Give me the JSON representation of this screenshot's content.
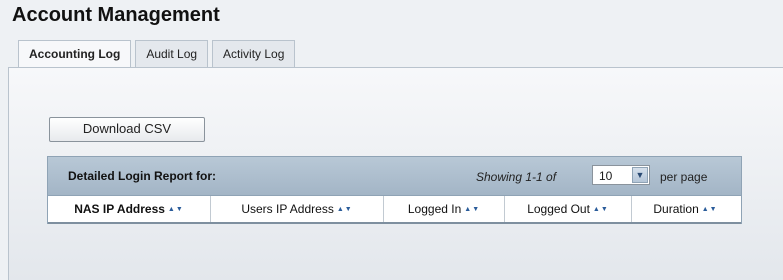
{
  "page": {
    "title": "Account Management"
  },
  "tabs": [
    {
      "label": "Accounting Log",
      "active": true
    },
    {
      "label": "Audit Log",
      "active": false
    },
    {
      "label": "Activity Log",
      "active": false
    }
  ],
  "toolbar": {
    "download_label": "Download CSV"
  },
  "report": {
    "title": "Detailed Login Report for:",
    "showing": "Showing 1-1 of",
    "per_page_value": "10",
    "per_page_label": "per page",
    "columns": [
      "NAS IP Address",
      "Users IP Address",
      "Logged In",
      "Logged Out",
      "Duration"
    ]
  },
  "icons": {
    "sort": "sort-arrows-icon",
    "dropdown": "chevron-down-icon"
  },
  "colors": {
    "header_bg": "#a9bacb",
    "background": "#eef1f4",
    "sort_arrow": "#2a5c9a"
  }
}
